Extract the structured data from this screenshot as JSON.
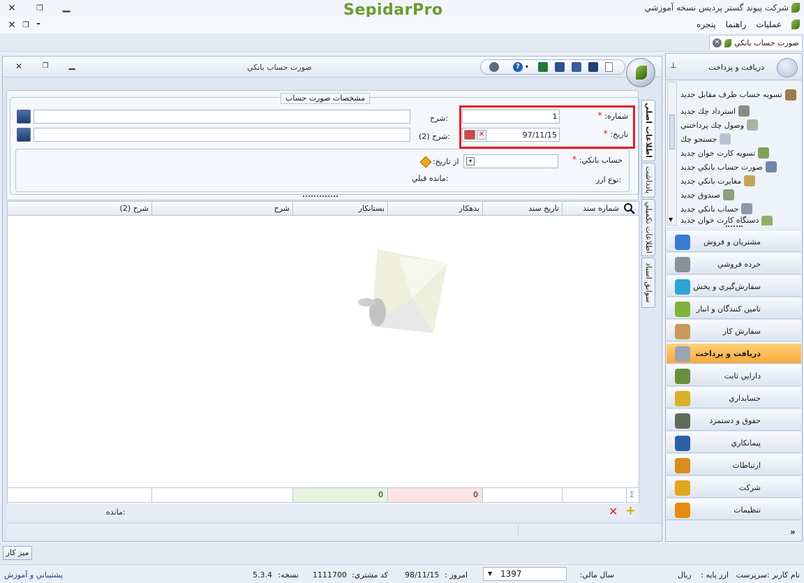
{
  "app": {
    "brand": "SepidarPro",
    "company_title": "شركت پيوند گستر پرديس نسخه آموزشي"
  },
  "menu": {
    "items": [
      "عمليات",
      "راهنما",
      "پنجره"
    ]
  },
  "document_tab": {
    "label": "صورت حساب بانکي"
  },
  "child_window": {
    "title": "صورت حساب بانکي"
  },
  "form": {
    "group_title": "مشخصات صورت حساب",
    "number_label": "شماره:",
    "number_value": "1",
    "date_label": "تاريخ:",
    "date_value": "97/11/15",
    "desc_label": "شرح:",
    "desc_value": "",
    "desc2_label": "شرح (2):",
    "desc2_value": "",
    "bank_account_label": "حساب بانکي:",
    "from_date_label": "از تاريخ:",
    "currency_type_label": "نوع ارز:",
    "prev_balance_label": "مانده قبلي:",
    "required_mark": "*"
  },
  "side_tabs": [
    "اطلاعات اصلي",
    "يادداشت",
    "اطلاعات تکميلي",
    "سوابق اسناد"
  ],
  "grid": {
    "columns": [
      "شماره سند",
      "تاريخ سند",
      "بدهکار",
      "بستانکار",
      "شرح",
      "شرح (2)"
    ],
    "totals": {
      "debit": "0",
      "credit": "0",
      "sigma": "Σ"
    },
    "balance_label": "مانده:"
  },
  "nav": {
    "header": "دريافت و پرداخت",
    "sub_items": [
      "تسويه حساب طرف مقابل جديد",
      "استرداد چك جديد",
      "وصول چك پرداختني",
      "جستجو چك",
      "تسويه كارت خوان جديد",
      "صورت حساب بانکي جديد",
      "مغايرت بانکي جديد",
      "صندوق جديد",
      "حساب بانکي جديد",
      "دستگاه کارت خوان جديد"
    ],
    "modules": [
      {
        "label": "مشتريان و فروش",
        "color": "#3a7bd5"
      },
      {
        "label": "خرده فروشي",
        "color": "#8a8f99"
      },
      {
        "label": "سفارش‌گيري و پخش",
        "color": "#2fa3d6"
      },
      {
        "label": "تامين کنندگان و انبار",
        "color": "#7fb23a"
      },
      {
        "label": "سفارش کار",
        "color": "#c79a5a"
      },
      {
        "label": "دريافت و پرداخت",
        "color": "#9aa4b2",
        "active": true
      },
      {
        "label": "دارايي ثابت",
        "color": "#6a8f3a"
      },
      {
        "label": "حسابداري",
        "color": "#d9b02a"
      },
      {
        "label": "حقوق و دستمزد",
        "color": "#5f6b58"
      },
      {
        "label": "پيمانکاري",
        "color": "#2b5fa6"
      },
      {
        "label": "ارتباطات",
        "color": "#d98c1e"
      },
      {
        "label": "شرکت",
        "color": "#e0a81c"
      },
      {
        "label": "تنظيمات",
        "color": "#e58a12"
      }
    ]
  },
  "taskbar": {
    "desktop_button": "ميز كار"
  },
  "status": {
    "user_label": "نام کاربر :",
    "user_value": "سرپرست",
    "base_currency_label": "ارز پايه :",
    "base_currency_value": "ريال",
    "fiscal_year_label": "سال مالي:",
    "fiscal_year_value": "1397",
    "today_label": "امروز :",
    "today_value": "98/11/15",
    "customer_code_label": "كد مشتري:",
    "customer_code_value": "1111700",
    "version_label": "نسخه:",
    "version_value": "5.3.4",
    "support_link": "پشتيباني و آموزش"
  },
  "colors": {
    "highlight_box": "#e0202a",
    "active_module": "#f7a93a",
    "brand_green": "#5c8a2a"
  }
}
